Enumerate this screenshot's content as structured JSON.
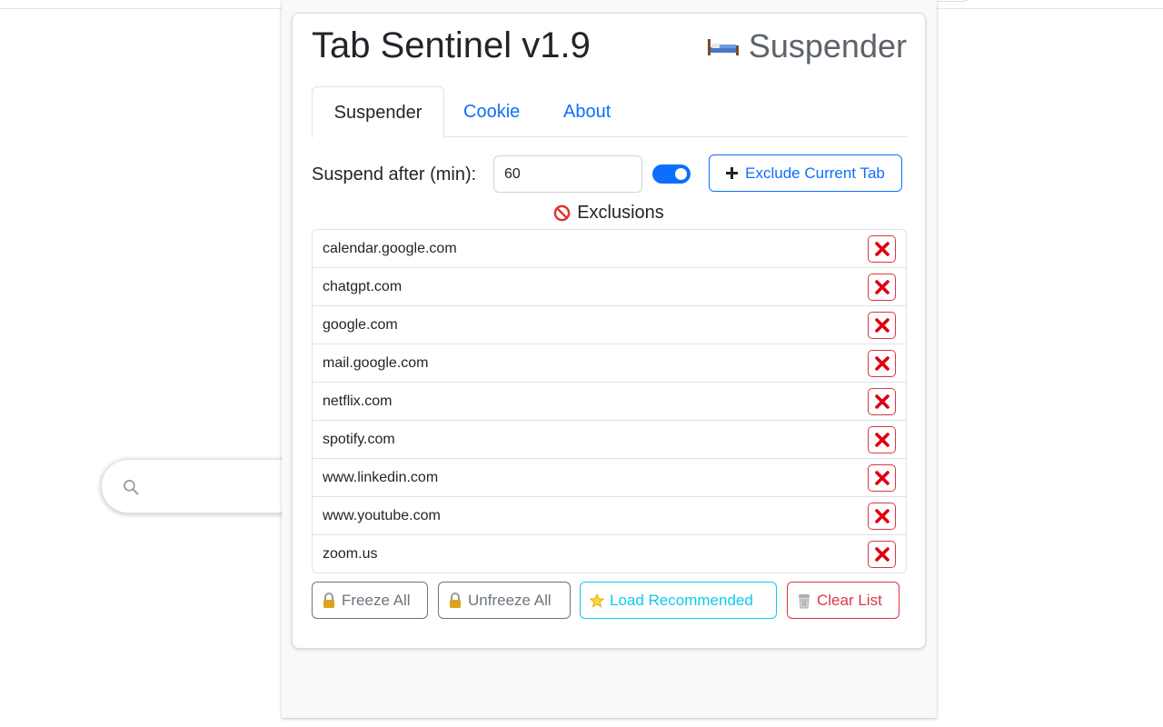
{
  "popup": {
    "title": "Tab Sentinel v1.9",
    "mode_icon": "bed-icon",
    "mode_label": "Suspender"
  },
  "tabs": [
    {
      "label": "Suspender",
      "active": true
    },
    {
      "label": "Cookie",
      "active": false
    },
    {
      "label": "About",
      "active": false
    }
  ],
  "settings": {
    "suspend_label": "Suspend after (min):",
    "suspend_value": "60",
    "toggle_on": true,
    "exclude_button": "Exclude Current Tab"
  },
  "exclusions": {
    "heading": "Exclusions",
    "heading_icon": "no-entry-icon",
    "items": [
      "calendar.google.com",
      "chatgpt.com",
      "google.com",
      "mail.google.com",
      "netflix.com",
      "spotify.com",
      "www.linkedin.com",
      "www.youtube.com",
      "zoom.us"
    ],
    "remove_icon": "red-x-icon"
  },
  "actions": {
    "freeze_all": "Freeze All",
    "unfreeze_all": "Unfreeze All",
    "load_recommended": "Load Recommended",
    "clear_list": "Clear List"
  },
  "colors": {
    "primary": "#0d6efd",
    "danger": "#dc3545",
    "info": "#0dcaf0",
    "secondary": "#6c757d"
  }
}
